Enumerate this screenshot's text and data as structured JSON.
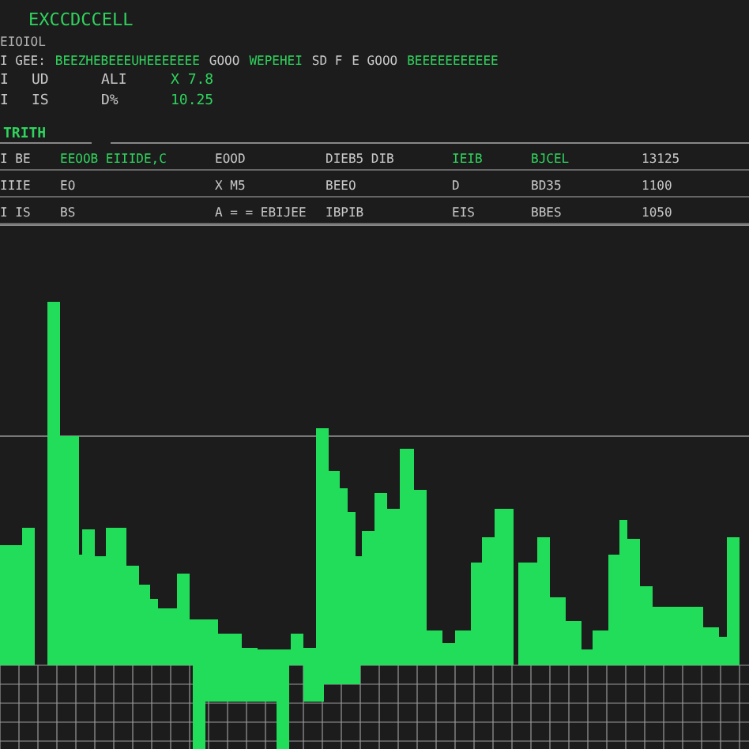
{
  "title": "EXCCDCCELL",
  "subtitle": "EIOIOL",
  "header_line": [
    {
      "text": "I GEE:",
      "accent": false
    },
    {
      "text": "BEEZHEBEEEUHEEEEEEE",
      "accent": true
    },
    {
      "text": "GOOO",
      "accent": false
    },
    {
      "text": "WEPEHEI",
      "accent": true
    },
    {
      "text": "SD F",
      "accent": false
    },
    {
      "text": "E GOOO",
      "accent": false
    },
    {
      "text": "BEEEEEEEEEEE",
      "accent": true
    }
  ],
  "stat_rows": [
    [
      {
        "text": "I",
        "accent": false
      },
      {
        "text": "UD",
        "accent": false
      },
      {
        "text": "ALI",
        "accent": false
      },
      {
        "text": "X 7.8",
        "accent": true
      }
    ],
    [
      {
        "text": "I",
        "accent": false
      },
      {
        "text": "IS",
        "accent": false
      },
      {
        "text": "D%",
        "accent": false
      },
      {
        "text": "10.25",
        "accent": true
      }
    ]
  ],
  "section_title": "TRITH",
  "table_rows": [
    [
      {
        "text": "I BE",
        "accent": false
      },
      {
        "text": "EEOOB EIIIDE,C",
        "accent": true
      },
      {
        "text": "EOOD",
        "accent": false
      },
      {
        "text": "DIEB5 DIB",
        "accent": false
      },
      {
        "text": "IEIB",
        "accent": true
      },
      {
        "text": "BJCEL",
        "accent": true
      },
      {
        "text": "13125",
        "accent": false
      }
    ],
    [
      {
        "text": "IIIE",
        "accent": false
      },
      {
        "text": "EO",
        "accent": false
      },
      {
        "text": "X M5",
        "accent": false
      },
      {
        "text": "BEEO",
        "accent": false
      },
      {
        "text": "D",
        "accent": false
      },
      {
        "text": "BD35",
        "accent": false
      },
      {
        "text": "1100",
        "accent": false
      }
    ],
    [
      {
        "text": "I IS",
        "accent": false
      },
      {
        "text": "BS",
        "accent": false
      },
      {
        "text": "A = = EBIJEE",
        "accent": false
      },
      {
        "text": "IBPIB",
        "accent": false
      },
      {
        "text": "EIS",
        "accent": false
      },
      {
        "text": "BBES",
        "accent": false
      },
      {
        "text": "1050",
        "accent": false
      }
    ]
  ]
}
